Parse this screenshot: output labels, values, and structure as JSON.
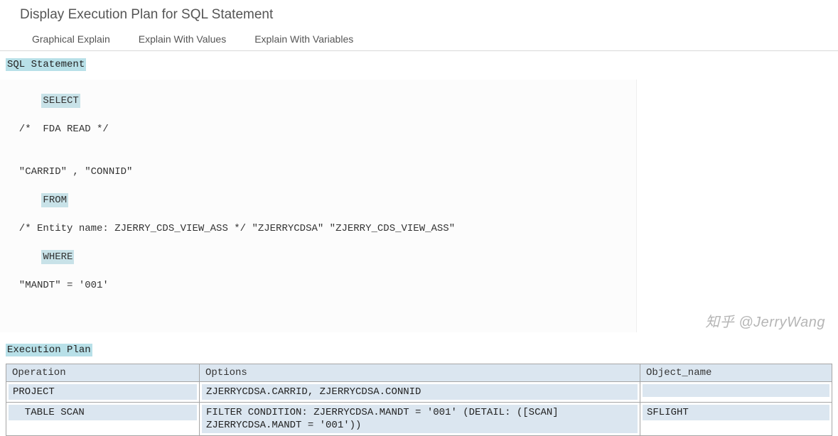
{
  "header": {
    "title": "Display Execution Plan for SQL Statement"
  },
  "tabs": [
    {
      "label": "Graphical Explain"
    },
    {
      "label": "Explain With Values"
    },
    {
      "label": "Explain With Variables"
    }
  ],
  "sections": {
    "sql_heading": "SQL Statement",
    "plan_heading": "Execution Plan"
  },
  "sql": {
    "kw_select": "SELECT",
    "line_comment1": "  /*  FDA READ */",
    "line_columns": "  \"CARRID\" , \"CONNID\"",
    "kw_from": "FROM",
    "line_entity": "  /* Entity name: ZJERRY_CDS_VIEW_ASS */ \"ZJERRYCDSA\" \"ZJERRY_CDS_VIEW_ASS\"",
    "kw_where": "WHERE",
    "line_where": "  \"MANDT\" = '001'"
  },
  "plan": {
    "columns": {
      "operation": "Operation",
      "options": "Options",
      "object_name": "Object_name"
    },
    "rows": [
      {
        "operation": "PROJECT",
        "options": "ZJERRYCDSA.CARRID, ZJERRYCDSA.CONNID",
        "object_name": ""
      },
      {
        "operation": "  TABLE SCAN",
        "options": "FILTER CONDITION: ZJERRYCDSA.MANDT = '001' (DETAIL: ([SCAN] ZJERRYCDSA.MANDT = '001'))",
        "object_name": "SFLIGHT"
      }
    ]
  },
  "watermark": "知乎 @JerryWang"
}
